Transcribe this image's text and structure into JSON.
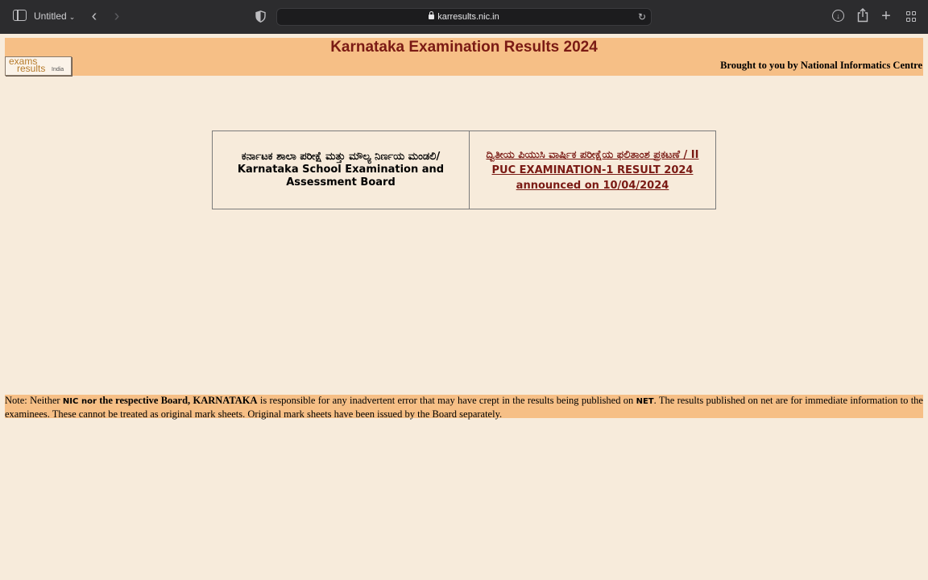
{
  "browser": {
    "tab_title": "Untitled",
    "url": "karresults.nic.in"
  },
  "header": {
    "title": "Karnataka Examination Results 2024",
    "brought_by": "Brought to you by National Informatics Centre",
    "logo": {
      "line1": "exams",
      "line2": "results",
      "line3": "India"
    }
  },
  "board": {
    "left_kannada": "ಕರ್ನಾಟಕ ಶಾಲಾ ಪರೀಕ್ಷೆ ಮತ್ತು ಮೌಲ್ಯ ನಿರ್ಣಯ ಮಂಡಲಿ/",
    "left_english": "Karnataka School Examination and Assessment Board",
    "result_link": "ದ್ವಿತೀಯ ಪಿಯುಸಿ ವಾರ್ಷಿಕ ಪರೀಕ್ಷೆಯ ಫಲಿತಾಂಶ ಪ್ರಕಟಣೆ / II PUC EXAMINATION-1 RESULT 2024 announced on 10/04/2024"
  },
  "note": {
    "p1": "Note: Neither ",
    "nic": "NIC nor",
    "p2": " the respective Board, KARNATAKA",
    "p3": " is responsible for any inadvertent error that may have crept in the results being published on ",
    "net": "NET",
    "p4": ". The results published on net are for immediate information to the examinees. These cannot be treated as original mark sheets. Original mark sheets have been issued by the Board separately."
  }
}
